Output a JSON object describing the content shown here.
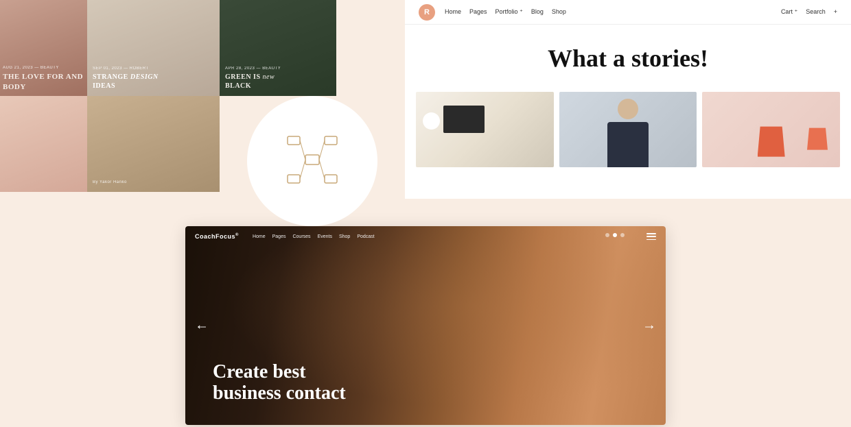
{
  "left_panel": {
    "cards": [
      {
        "id": "card-1",
        "meta": "AUG 21, 2023 — BEAUTY",
        "title": "THE LOVE for AND BODY",
        "color": "#c8a090"
      },
      {
        "id": "card-2",
        "meta": "SEP 01, 2023 — ROBERT",
        "title": "STRANGE design IDEAS",
        "color": "#d4c8b8"
      },
      {
        "id": "card-3",
        "meta": "APR 28, 2023 — BEAUTY",
        "title_prefix": "GREEN IS ",
        "title_italic": "new",
        "title_suffix": " BLACK",
        "color": "#3a4a38"
      },
      {
        "id": "card-4",
        "meta": "",
        "title": "",
        "color": "#e8c8b8"
      },
      {
        "id": "card-5",
        "meta": "By Yakor Hanko",
        "title": "",
        "color": "#c8b090"
      }
    ]
  },
  "network_icon": {
    "label": "network-diagram"
  },
  "right_panel": {
    "nav": {
      "logo_letter": "R",
      "links": [
        "Home",
        "Pages",
        "Portfolio ⁺",
        "Blog",
        "Shop"
      ],
      "right_links": [
        "Cart ⁺",
        "Search",
        "+"
      ]
    },
    "hero": {
      "headline": "What a stories!"
    },
    "images": [
      {
        "id": "desk-laptop",
        "alt": "Desk with laptop and mug"
      },
      {
        "id": "smiling-person",
        "alt": "Smiling person"
      },
      {
        "id": "shopping-bags",
        "alt": "Shopping bags"
      }
    ]
  },
  "bottom_panel": {
    "nav": {
      "logo": "CoachFocus",
      "logo_sup": "®",
      "links": [
        "Home",
        "Pages",
        "Courses",
        "Events",
        "Shop",
        "Podcast"
      ]
    },
    "hero": {
      "headline_line1": "Create best",
      "headline_line2": "business contact"
    },
    "dots": [
      "dot1",
      "dot2",
      "dot3"
    ],
    "arrow_left": "←",
    "arrow_right": "→"
  }
}
